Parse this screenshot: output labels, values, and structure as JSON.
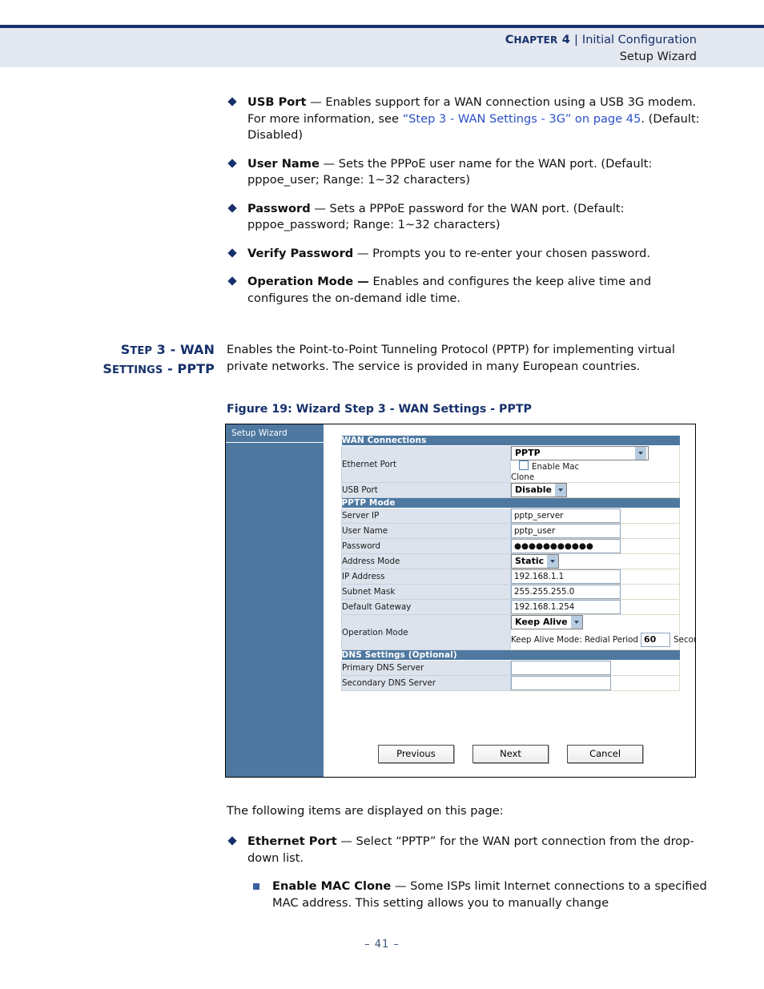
{
  "header": {
    "chapter": "CHAPTER 4",
    "separator": "|",
    "doc_title": "Initial Configuration",
    "subtitle": "Setup Wizard"
  },
  "bullets_top": [
    {
      "term": "USB Port",
      "dash": "—",
      "text_1": " Enables support for a WAN connection using a USB 3G modem. For more information, see ",
      "xref": "“Step 3 - WAN Settings - 3G” on page 45",
      "text_2": ". (Default: Disabled)"
    },
    {
      "term": "User Name",
      "dash": "—",
      "text_1": " Sets the PPPoE user name for the WAN port. (Default: pppoe_user; Range: 1~32 characters)"
    },
    {
      "term": "Password",
      "dash": "—",
      "text_1": " Sets a PPPoE password for the WAN port. (Default: pppoe_password; Range: 1~32 characters)"
    },
    {
      "term": "Verify Password",
      "dash": "—",
      "text_1": " Prompts you to re-enter your chosen password."
    },
    {
      "term": "Operation Mode —",
      "dash": "",
      "text_1": " Enables and configures the keep alive time and configures the on-demand idle time."
    }
  ],
  "section": {
    "side_heading_line1": "STEP 3 - WAN",
    "side_heading_line2": "SETTINGS - PPTP",
    "lead_paragraph": "Enables the Point-to-Point Tunneling Protocol (PPTP) for implementing virtual private networks. The service is provided in many European countries.",
    "figure_caption": "Figure 19:  Wizard Step 3 - WAN Settings - PPTP"
  },
  "figure": {
    "sidebar_title": "Setup Wizard",
    "sections": {
      "wan_connections": "WAN Connections",
      "pptp_mode": "PPTP Mode",
      "dns_settings": "DNS Settings (Optional)"
    },
    "rows": {
      "ethernet_port": {
        "label": "Ethernet Port",
        "value": "PPTP",
        "checkbox_label": "Enable Mac",
        "checkbox_label_wrap": "Clone",
        "checked": false
      },
      "usb_port": {
        "label": "USB Port",
        "value": "Disable"
      },
      "server_ip": {
        "label": "Server IP",
        "value": "pptp_server"
      },
      "user_name": {
        "label": "User Name",
        "value": "pptp_user"
      },
      "password": {
        "label": "Password",
        "value": "●●●●●●●●●●●"
      },
      "address_mode": {
        "label": "Address Mode",
        "value": "Static"
      },
      "ip_address": {
        "label": "IP Address",
        "value": "192.168.1.1"
      },
      "subnet_mask": {
        "label": "Subnet Mask",
        "value": "255.255.255.0"
      },
      "default_gateway": {
        "label": "Default Gateway",
        "value": "192.168.1.254"
      },
      "operation_mode": {
        "label": "Operation Mode",
        "value": "Keep Alive",
        "redial_prefix": "Keep Alive Mode: Redial Period",
        "redial_value": "60",
        "redial_unit": "Seconds"
      },
      "primary_dns": {
        "label": "Primary DNS Server",
        "value": ""
      },
      "secondary_dns": {
        "label": "Secondary DNS Server",
        "value": ""
      }
    },
    "buttons": {
      "previous": "Previous",
      "next": "Next",
      "cancel": "Cancel"
    },
    "colors": {
      "sidebar_blue": "#4e78a0",
      "section_header_blue": "#4e78a0",
      "label_cell": "#dde3ec"
    }
  },
  "following": {
    "intro": "The following items are displayed on this page:",
    "bullets": [
      {
        "term": "Ethernet Port",
        "dash": "—",
        "text_1": " Select “PPTP” for the WAN port connection from the drop-down list."
      }
    ],
    "subbullets": [
      {
        "term": "Enable MAC Clone",
        "dash": "—",
        "text_1": " Some ISPs limit Internet connections to a specified MAC address. This setting allows you to manually change"
      }
    ]
  },
  "footer": {
    "page_number": "–  41  –"
  }
}
